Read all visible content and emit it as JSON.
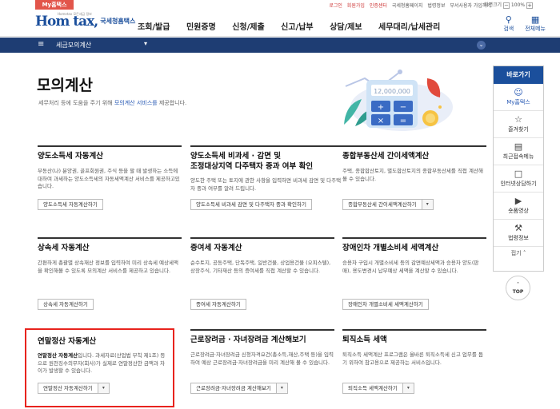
{
  "topbar": {
    "my_tab": "My홈택스",
    "util_links": [
      "로그인",
      "회원가입",
      "인증센터",
      "국세청홈페이지",
      "법령정보",
      "부서사용자 가입하기"
    ],
    "zoom_label": "화면크기",
    "zoom_value": "100%"
  },
  "header": {
    "logo_small": "Hometax 모든세금 정보",
    "logo_text": "Hom tax,",
    "logo_korean": "국세청홈택스",
    "gnb": [
      "조회/발급",
      "민원증명",
      "신청/제출",
      "신고/납부",
      "상담/제보",
      "세무대리/납세관리"
    ],
    "search_label": "검색",
    "allmenu_label": "전체메뉴"
  },
  "navbar": {
    "breadcrumb": "세금모의계산"
  },
  "hero": {
    "title": "모의계산",
    "desc_before": "세무처리 등에 도움을 주기 위해 ",
    "desc_link": "모의계산 서비스를",
    "desc_after": " 제공합니다.",
    "calc_display": "12,000,000"
  },
  "quick": {
    "title": "바로가기",
    "items": [
      "My홈택스",
      "즐겨찾기",
      "최근접속메뉴",
      "인터넷상담하기",
      "숏폼영상",
      "법령정보"
    ],
    "fold": "접기",
    "top": "TOP"
  },
  "cards": [
    {
      "title1": "양도소득세 자동계산",
      "title2": "",
      "desc": "부동산(나) 분양권, 골프회원권, 주식 등을 팔 때 발생하는 소득에 대하여 과세하는 양도소득세의 자동세액계산 서비스를 제공하고있습니다.",
      "button": "양도소득세 자동계산하기",
      "has_dropdown": false
    },
    {
      "title1": "양도소득세 비과세 · 감면 및",
      "title2": "조정대상지역 다주택자 중과 여부 확인",
      "desc": "양도한 주택 또는 토지에 관한 사항을 입력하면 비과세 감면 및 다주택자 중과 여부를 알려 드립니다.",
      "button": "양도소득세 비과세 감면 및 다주택자 중과 확인하기",
      "has_dropdown": false
    },
    {
      "title1": "종합부동산세 간이세액계산",
      "title2": "",
      "desc": "주택, 종합합산토지, 별도합산토지의 종합부동산세를 직접 계산해 볼 수 있습니다.",
      "button": "종합부동산세 간이세액계산하기",
      "has_dropdown": true
    },
    {
      "title1": "상속세 자동계산",
      "title2": "",
      "desc": "간편하게 총괄별 상속재산 정보를 입력하여 미리 상속세 예상세액을 확인해볼 수 있도록 모의계산 서비스를 제공하고 있습니다.",
      "button": "상속세 자동계산하기",
      "has_dropdown": false
    },
    {
      "title1": "증여세 자동계산",
      "title2": "",
      "desc": "순수토지, 공동주택, 단독주택, 일반건물, 상업용건물 (오피스텔), 상장주식, 기타재산 등의 증여세를 직접 계산할 수 있습니다.",
      "button": "증여세 자동계산하기",
      "has_dropdown": false
    },
    {
      "title1": "장애인차 개별소비세 세액계산",
      "title2": "",
      "desc": "승용차 구입시 개별소비세 등의 감면예상세액과 승용차 양도(판매), 용도변경시 납부예상 세액을 계산할 수 있습니다.",
      "button": "장애인차 개별소비세 세액계산하기",
      "has_dropdown": false
    },
    {
      "title1": "연말정산 자동계산",
      "title2": "",
      "desc_bold": "연말정산 자동계산",
      "desc": "입니다. 과세자료(산업법 부칙 제1조) 등으로 원천징수의무자(회사)가 실제로 연말정산한 금액과 차이가 발생할 수 있습니다.",
      "button": "연말정산 자동계산하기",
      "has_dropdown": true
    },
    {
      "title1": "근로장려금 · 자녀장려금 계산해보기",
      "title2": "",
      "desc": "근로장려금·자녀장려금 신청자격요건(총소득,재산,주택 등)을 입력하여 예상 근로장려금·자녀장려금을 미리 계산해 볼 수 있습니다.",
      "button": "근로장려금·자녀장려금 계산해보기",
      "has_dropdown": true
    },
    {
      "title1": "퇴직소득 세액",
      "title2": "",
      "desc": "퇴직소득 세액계산 프로그램은 올바른 퇴직소득세 신고 업무를 돕기 위하여 참고용으로 제공하는 서비스입니다.",
      "button": "퇴직소득 세액계산하기",
      "has_dropdown": true
    }
  ]
}
